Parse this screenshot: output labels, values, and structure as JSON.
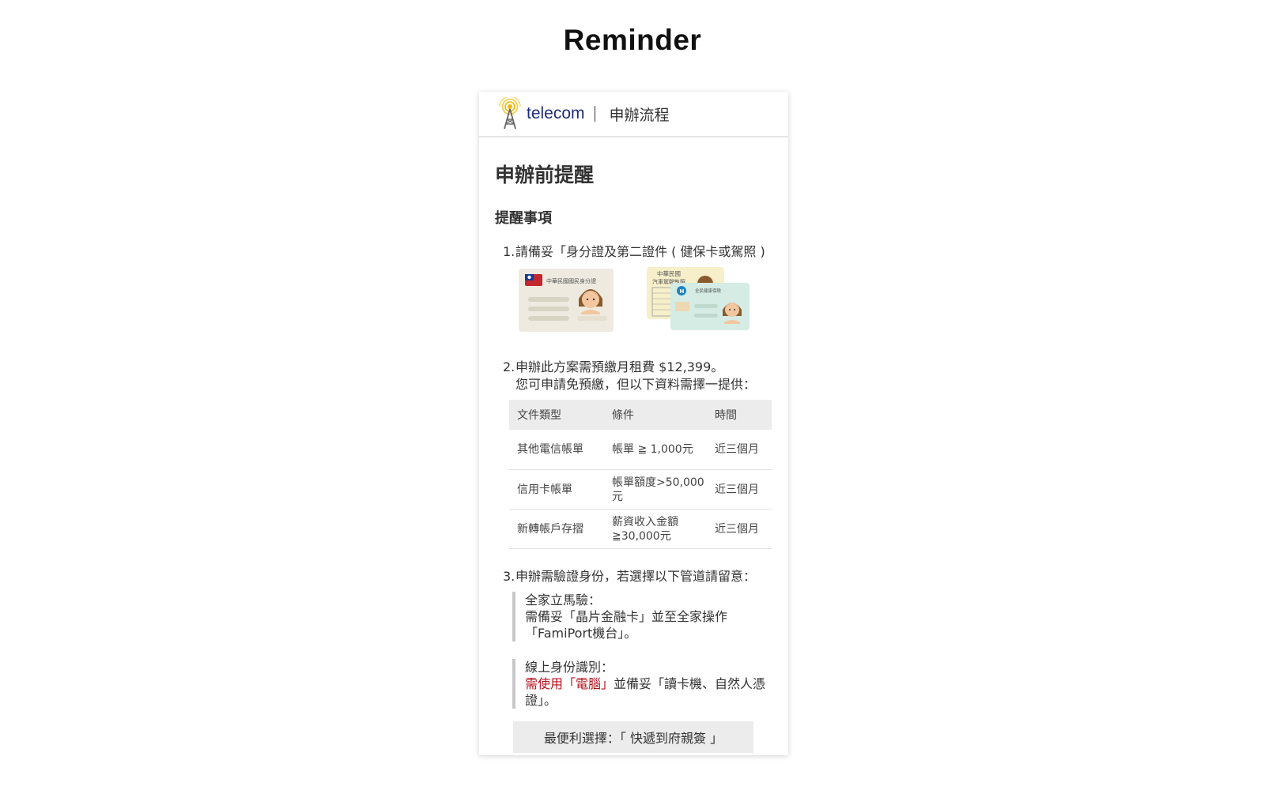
{
  "page": {
    "title": "Reminder"
  },
  "header": {
    "brand": "telecom",
    "subtitle": "申辦流程",
    "logo_icon": "antenna-tower-icon"
  },
  "main": {
    "heading": "申辦前提醒",
    "section_title": "提醒事項",
    "items": [
      {
        "number": "1.",
        "text": "請備妥「身分證及第二證件 ( 健保卡或駕照 )",
        "id_card_label": "中華民國國民身分證",
        "license_label_1": "中華民國",
        "license_label_2": "汽車駕駛執照",
        "health_card_label": "全民健康保險"
      },
      {
        "number": "2.",
        "text_line1": "申辦此方案需預繳月租費 $12,399。",
        "text_line2": "您可申請免預繳，但以下資料需擇一提供：",
        "table": {
          "headers": [
            "文件類型",
            "條件",
            "時間"
          ],
          "rows": [
            [
              "其他電信帳單",
              "帳單 ≧ 1,000元",
              "近三個月"
            ],
            [
              "信用卡帳單",
              "帳單額度>50,000元",
              "近三個月"
            ],
            [
              "新轉帳戶存摺",
              "薪資收入金額≧30,000元",
              "近三個月"
            ]
          ]
        }
      },
      {
        "number": "3.",
        "text": "申辦需驗證身份，若選擇以下管道請留意：",
        "notes": [
          {
            "title": "全家立馬驗：",
            "body": "需備妥「晶片金融卡」並至全家操作「FamiPort機台」。"
          },
          {
            "title": "線上身份識別：",
            "highlight": "需使用「電腦」",
            "body": "並備妥「讀卡機、自然人憑證」。"
          }
        ]
      }
    ],
    "best_choice_button": "最便利選擇：「 快遞到府親簽 」"
  },
  "colors": {
    "brand": "#1f2d7a",
    "highlight": "#b5121b",
    "table_header_bg": "#ececec"
  }
}
